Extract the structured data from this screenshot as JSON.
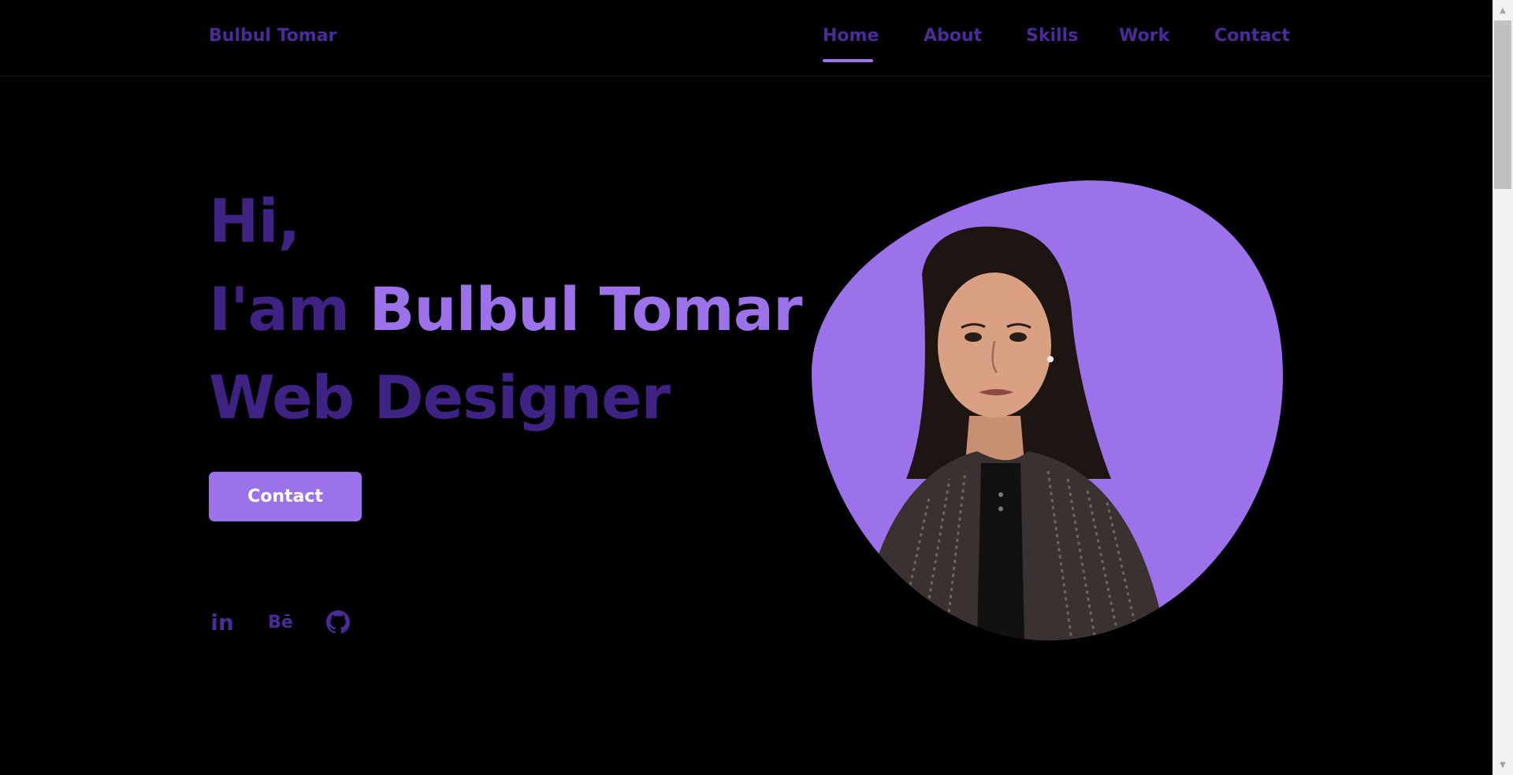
{
  "brand": {
    "name": "Bulbul Tomar"
  },
  "nav": {
    "items": [
      {
        "label": "Home",
        "active": true
      },
      {
        "label": "About",
        "active": false
      },
      {
        "label": "Skills",
        "active": false
      },
      {
        "label": "Work",
        "active": false
      },
      {
        "label": "Contact",
        "active": false
      }
    ]
  },
  "hero": {
    "greeting": "Hi,",
    "intro_prefix": "I'am ",
    "intro_name": "Bulbul Tomar",
    "role": "Web Designer",
    "cta_label": "Contact"
  },
  "social": [
    {
      "icon": "linkedin-icon",
      "glyph": "in"
    },
    {
      "icon": "behance-icon",
      "glyph": "Bē"
    },
    {
      "icon": "github-icon",
      "glyph": ""
    }
  ],
  "colors": {
    "background": "#000000",
    "accent": "#9b72ea",
    "accent_dark": "#4b2a9a"
  }
}
